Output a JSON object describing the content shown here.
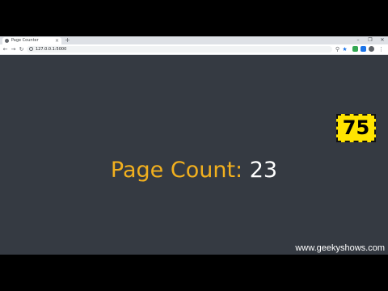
{
  "browser": {
    "tab_title": "Page Counter",
    "tab_close": "×",
    "new_tab": "+",
    "controls": {
      "minimize": "–",
      "maximize": "❐",
      "close": "✕"
    },
    "nav": {
      "back": "←",
      "forward": "→",
      "reload": "↻"
    },
    "url": "127.0.0.1:5000",
    "menu": "⋮",
    "star": "★"
  },
  "page": {
    "counter_label": "Page Count:",
    "counter_value": "23"
  },
  "overlay": {
    "badge_number": "75",
    "badge_color": "#ffe400",
    "watermark": "www.geekyshows.com"
  },
  "colors": {
    "page_background": "#353a42",
    "label_color": "#f2b01e",
    "value_color": "#ffffff"
  }
}
